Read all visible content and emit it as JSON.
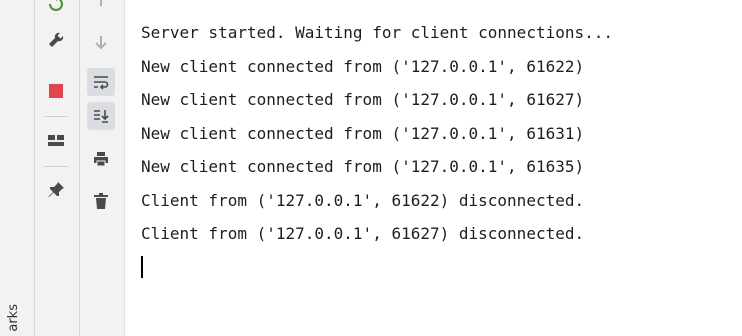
{
  "side_panel": {
    "label": "arks"
  },
  "console": {
    "lines": [
      "Server started. Waiting for client connections...",
      "New client connected from ('127.0.0.1', 61622)",
      "New client connected from ('127.0.0.1', 61627)",
      "New client connected from ('127.0.0.1', 61631)",
      "New client connected from ('127.0.0.1', 61635)",
      "Client from ('127.0.0.1', 61622) disconnected.",
      "Client from ('127.0.0.1', 61627) disconnected."
    ]
  },
  "toolbar": {
    "left_icons": [
      "rerun-icon",
      "wrench-icon",
      "stop-icon",
      "layout-icon",
      "pin-icon"
    ],
    "right_icons": [
      "scroll-up-icon",
      "scroll-down-icon",
      "soft-wrap-icon",
      "scroll-to-end-icon",
      "print-icon",
      "trash-icon"
    ]
  },
  "colors": {
    "stop": "#e0464c",
    "console_text": "#1e1e1e",
    "toolbar_bg": "#f2f2f2",
    "active_button": "#dadde2"
  }
}
